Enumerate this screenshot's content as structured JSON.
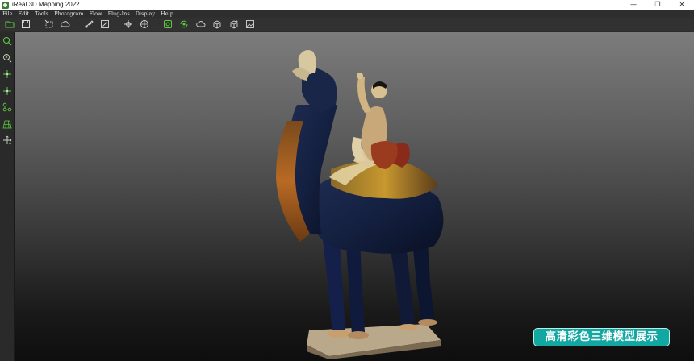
{
  "window": {
    "title": "iReal 3D Mapping 2022",
    "controls": {
      "minimize": "—",
      "maximize": "❐",
      "close": "✕"
    }
  },
  "menu": [
    "File",
    "Edit",
    "Tools",
    "Photogram",
    "Flow",
    "Plug-Ins",
    "Display",
    "Help"
  ],
  "toolbar": {
    "icons": [
      "open-folder-icon",
      "save-icon",
      "crop-icon",
      "cloud-icon",
      "brush-icon",
      "edit-icon",
      "target-icon",
      "crosshair-icon",
      "gear-flow-icon",
      "gear-refresh-icon",
      "cloud-outline-icon",
      "cube-icon",
      "cube-plus-icon",
      "image-icon"
    ]
  },
  "left_tools": {
    "icons": [
      "zoom-icon",
      "zoom-fit-icon",
      "axis-x-icon",
      "axis-y-icon",
      "connect-nodes-icon",
      "grid-mesh-icon",
      "pan-icon"
    ]
  },
  "colors": {
    "accent_green": "#5dcc3a",
    "caption_bg": "#13a7a2"
  },
  "caption": "高清彩色三维模型展示"
}
